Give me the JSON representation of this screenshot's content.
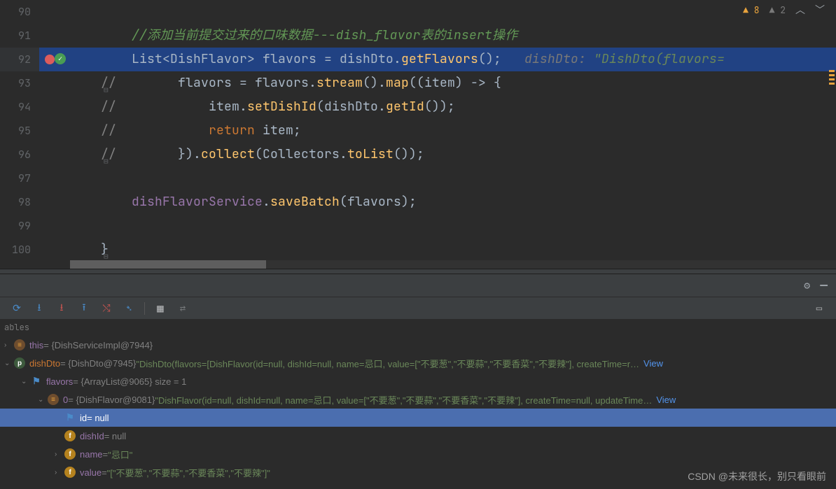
{
  "editor": {
    "badges": {
      "warn1_count": "8",
      "warn2_count": "2"
    },
    "lines": [
      {
        "no": "90",
        "segs": []
      },
      {
        "no": "91",
        "segs": [
          {
            "cls": "comment-cn",
            "t": "//添加当前提交过来的口味数据---dish_flavor表的insert操作"
          }
        ],
        "indent": "        "
      },
      {
        "no": "92",
        "highlighted": true,
        "bp": true,
        "segs": [
          {
            "cls": "type",
            "t": "List"
          },
          {
            "cls": "punct",
            "t": "<"
          },
          {
            "cls": "type",
            "t": "DishFlavor"
          },
          {
            "cls": "punct",
            "t": "> "
          },
          {
            "cls": "ident",
            "t": "flavors "
          },
          {
            "cls": "punct",
            "t": "= "
          },
          {
            "cls": "ident",
            "t": "dishDto"
          },
          {
            "cls": "punct",
            "t": "."
          },
          {
            "cls": "method",
            "t": "getFlavors"
          },
          {
            "cls": "punct",
            "t": "();   "
          },
          {
            "cls": "inlay",
            "t": "dishDto: "
          },
          {
            "cls": "string-inlay",
            "t": "\"DishDto(flavors="
          }
        ],
        "indent": "        "
      },
      {
        "no": "93",
        "fold": "⊟",
        "segs": [
          {
            "cls": "dim",
            "t": "//        "
          },
          {
            "cls": "ident",
            "t": "flavors "
          },
          {
            "cls": "punct",
            "t": "= "
          },
          {
            "cls": "ident",
            "t": "flavors"
          },
          {
            "cls": "punct",
            "t": "."
          },
          {
            "cls": "method",
            "t": "stream"
          },
          {
            "cls": "punct",
            "t": "()."
          },
          {
            "cls": "method",
            "t": "map"
          },
          {
            "cls": "punct",
            "t": "(("
          },
          {
            "cls": "ident",
            "t": "item"
          },
          {
            "cls": "punct",
            "t": ") -> {"
          }
        ],
        "indent": "    "
      },
      {
        "no": "94",
        "segs": [
          {
            "cls": "dim",
            "t": "//            "
          },
          {
            "cls": "ident",
            "t": "item"
          },
          {
            "cls": "punct",
            "t": "."
          },
          {
            "cls": "method",
            "t": "setDishId"
          },
          {
            "cls": "punct",
            "t": "("
          },
          {
            "cls": "ident",
            "t": "dishDto"
          },
          {
            "cls": "punct",
            "t": "."
          },
          {
            "cls": "method",
            "t": "getId"
          },
          {
            "cls": "punct",
            "t": "());"
          }
        ],
        "indent": "    "
      },
      {
        "no": "95",
        "segs": [
          {
            "cls": "dim",
            "t": "//            "
          },
          {
            "cls": "keyword",
            "t": "return "
          },
          {
            "cls": "ident",
            "t": "item"
          },
          {
            "cls": "punct",
            "t": ";"
          }
        ],
        "indent": "    "
      },
      {
        "no": "96",
        "fold": "⊟",
        "segs": [
          {
            "cls": "dim",
            "t": "//        "
          },
          {
            "cls": "punct",
            "t": "})."
          },
          {
            "cls": "method",
            "t": "collect"
          },
          {
            "cls": "punct",
            "t": "("
          },
          {
            "cls": "type",
            "t": "Collectors"
          },
          {
            "cls": "punct",
            "t": "."
          },
          {
            "cls": "method",
            "t": "toList"
          },
          {
            "cls": "punct",
            "t": "());"
          }
        ],
        "indent": "    "
      },
      {
        "no": "97",
        "segs": []
      },
      {
        "no": "98",
        "segs": [
          {
            "cls": "field",
            "t": "dishFlavorService"
          },
          {
            "cls": "punct",
            "t": "."
          },
          {
            "cls": "method",
            "t": "saveBatch"
          },
          {
            "cls": "punct",
            "t": "("
          },
          {
            "cls": "ident",
            "t": "flavors"
          },
          {
            "cls": "punct",
            "t": ");"
          }
        ],
        "indent": "        "
      },
      {
        "no": "99",
        "segs": []
      },
      {
        "no": "100",
        "fold": "⊟",
        "segs": [
          {
            "cls": "punct",
            "t": "}"
          }
        ],
        "indent": "    "
      }
    ]
  },
  "debugger": {
    "vars_label": "ables",
    "toolbar_right_label": "",
    "tree": [
      {
        "depth": 0,
        "expander": "›",
        "icon": "obj",
        "name": "this",
        "type": "",
        "val_gray": " = {DishServiceImpl@7944}"
      },
      {
        "depth": 0,
        "expander": "⌄",
        "icon": "p",
        "name_hl": "dishDto",
        "val_gray": " = {DishDto@7945} ",
        "str": "\"DishDto(flavors=[DishFlavor(id=null, dishId=null, name=忌口, value=[\"不要葱\",\"不要蒜\",\"不要香菜\",\"不要辣\"], createTime=r… ",
        "view": "View"
      },
      {
        "depth": 1,
        "expander": "⌄",
        "icon": "flag",
        "name": "flavors",
        "val_gray": " = {ArrayList@9065}  size = 1"
      },
      {
        "depth": 2,
        "expander": "⌄",
        "icon": "obj",
        "name": "0",
        "val_gray": " = {DishFlavor@9081} ",
        "str": "\"DishFlavor(id=null, dishId=null, name=忌口, value=[\"不要葱\",\"不要蒜\",\"不要香菜\",\"不要辣\"], createTime=null, updateTime… ",
        "view": "View"
      },
      {
        "depth": 3,
        "expander": "",
        "icon": "flag",
        "name": "id",
        "val_gray": " = null",
        "selected": true
      },
      {
        "depth": 3,
        "expander": "",
        "icon": "f",
        "name": "dishId",
        "val_gray": " = null"
      },
      {
        "depth": 3,
        "expander": "›",
        "icon": "f",
        "name": "name",
        "val_gray": " = ",
        "str": "\"忌口\""
      },
      {
        "depth": 3,
        "expander": "›",
        "icon": "f",
        "name": "value",
        "val_gray": " = ",
        "str": "\"[\"不要葱\",\"不要蒜\",\"不要香菜\",\"不要辣\"]\""
      }
    ]
  },
  "watermark": "CSDN @未来很长，别只看眼前"
}
